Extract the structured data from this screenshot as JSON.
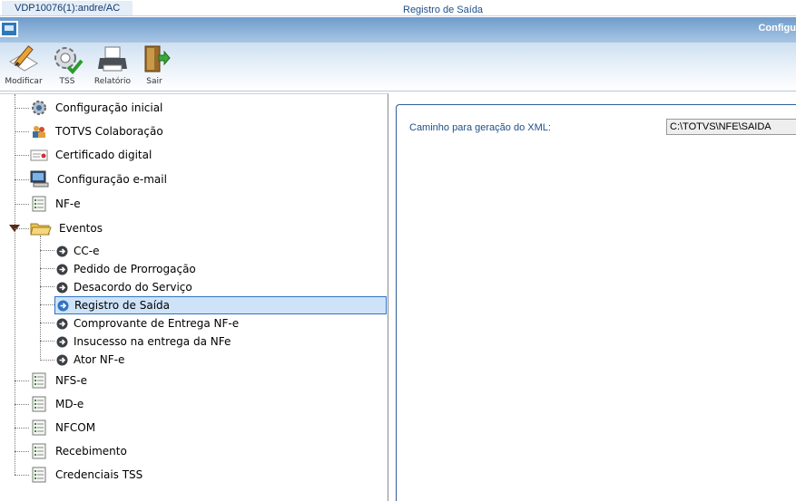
{
  "session_tab": "VDP10076(1):andre/AC",
  "window_title": "Configu",
  "toolbar": {
    "modificar": "Modificar",
    "tss": "TSS",
    "relatorio": "Relatório",
    "sair": "Sair"
  },
  "tree": {
    "configuracao_inicial": "Configuração inicial",
    "totvs_colaboracao": "TOTVS Colaboração",
    "certificado_digital": "Certificado digital",
    "configuracao_email": "Configuração e-mail",
    "nfe": "NF-e",
    "eventos": "Eventos",
    "eventos_children": [
      "CC-e",
      "Pedido de Prorrogação",
      "Desacordo do Serviço",
      "Registro de Saída",
      "Comprovante de Entrega NF-e",
      "Insucesso na entrega da NFe",
      "Ator NF-e"
    ],
    "nfse": "NFS-e",
    "mde": "MD-e",
    "nfcom": "NFCOM",
    "recebimento": "Recebimento",
    "credenciais_tss": "Credenciais TSS",
    "selected": "Registro de Saída"
  },
  "panel": {
    "group_title": "Registro de Saída",
    "field_label": "Caminho para geração do XML:",
    "field_value": "C:\\TOTVS\\NFE\\SAIDA"
  },
  "colors": {
    "header_blue": "#6f9ccb",
    "selection": "#cfe3f8",
    "selection_border": "#2f74c6",
    "label_blue": "#1e4f8a"
  },
  "icons": [
    "monitor-icon",
    "pencil-paper-icon",
    "gear-check-icon",
    "printer-icon",
    "exit-door-icon",
    "gear-icon",
    "people-icon",
    "certificate-icon",
    "computer-email-icon",
    "document-list-icon",
    "folder-icon",
    "arrow-circle-icon"
  ]
}
